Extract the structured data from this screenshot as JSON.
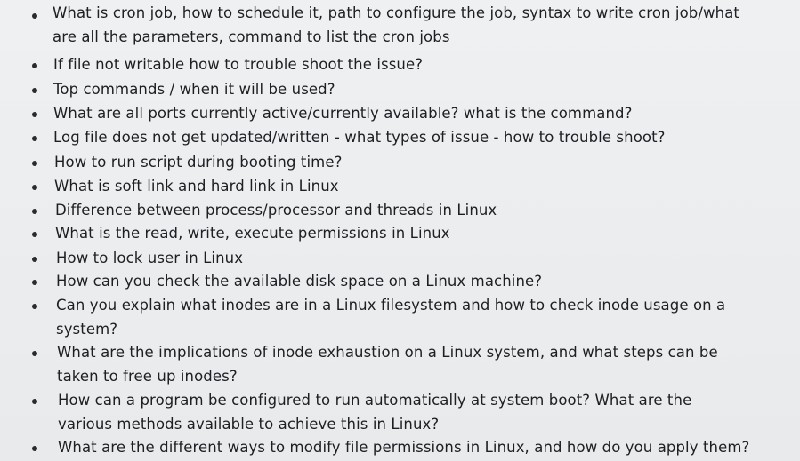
{
  "questions": [
    "What is cron job, how to schedule it, path to configure the job, syntax to write cron job/what\nare all the parameters, command to list the cron jobs",
    "If file not writable how to trouble shoot the issue?",
    "Top commands / when it will be used?",
    "What are all ports currently active/currently available? what is the command?",
    "Log file does not get updated/written - what types of issue - how to trouble shoot?",
    "How to run script during booting time?",
    "What is soft link and hard link in Linux",
    "Difference between process/processor and threads in Linux",
    "What is the read, write, execute permissions in Linux",
    "How to lock user in Linux",
    "How can you check the available disk space on a Linux machine?",
    "Can you explain what inodes are in a Linux filesystem and how to check inode usage on a\nsystem?",
    "What are the implications of inode exhaustion on a Linux system, and what steps can be\ntaken to free up inodes?",
    "How can a program be configured to run automatically at system boot? What are the\nvarious methods available to achieve this in Linux?",
    "What are the different ways to modify file permissions in Linux, and how do you apply them?"
  ]
}
